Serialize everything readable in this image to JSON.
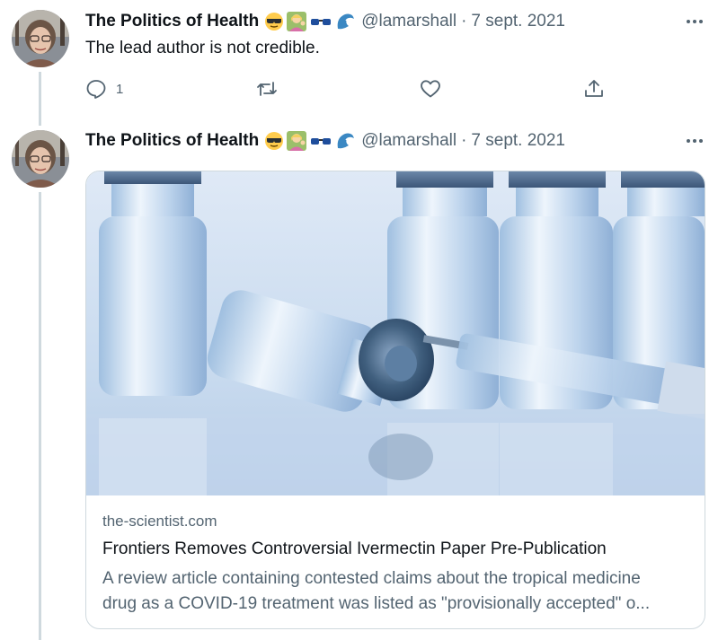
{
  "tweets": [
    {
      "author_name": "The Politics of Health",
      "emojis": [
        "sunglasses-face-emoji",
        "woman-tipping-hand-emoji",
        "glasses-emoji",
        "wave-emoji"
      ],
      "handle": "@lamarshall",
      "separator": "·",
      "date": "7 sept. 2021",
      "text": "The lead author is not credible.",
      "reply_count": "1"
    },
    {
      "author_name": "The Politics of Health",
      "emojis": [
        "sunglasses-face-emoji",
        "woman-tipping-hand-emoji",
        "glasses-emoji",
        "wave-emoji"
      ],
      "handle": "@lamarshall",
      "separator": "·",
      "date": "7 sept. 2021",
      "card": {
        "domain": "the-scientist.com",
        "title": "Frontiers Removes Controversial Ivermectin Paper Pre-Publication",
        "description_line1": "A review article containing contested claims about the tropical medicine",
        "description_line2": "drug as a COVID-19 treatment was listed as \"provisionally accepted\" o..."
      }
    }
  ],
  "colors": {
    "text_primary": "#0f1419",
    "text_secondary": "#536471",
    "thread_line": "#cfd9de",
    "border": "#cfd9de"
  }
}
